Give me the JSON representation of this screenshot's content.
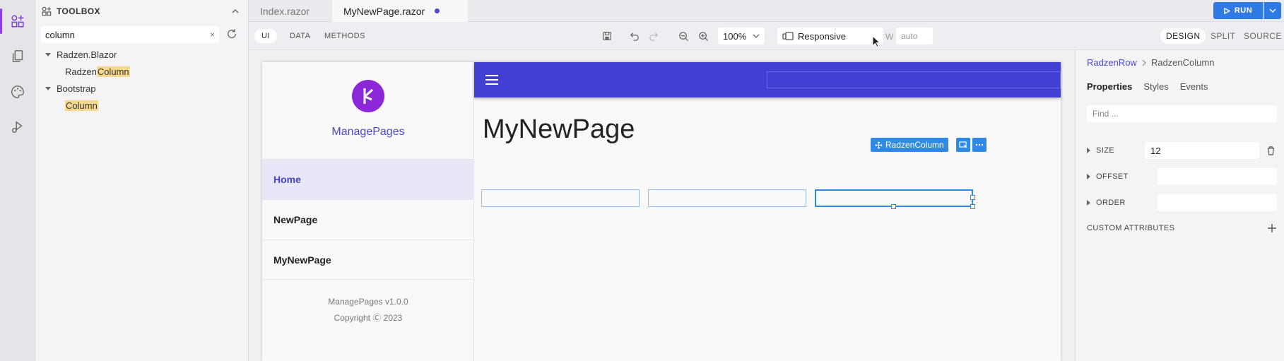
{
  "toolbox": {
    "title": "TOOLBOX",
    "search_value": "column",
    "clear_glyph": "×",
    "tree": [
      {
        "group": "Radzen.Blazor",
        "item_prefix": "Radzen",
        "item_match": "Column"
      },
      {
        "group": "Bootstrap",
        "item_prefix": "",
        "item_match": "Column"
      }
    ]
  },
  "tabs": [
    {
      "label": "Index.razor"
    },
    {
      "label": "MyNewPage.razor"
    }
  ],
  "run_label": "RUN",
  "toolbar": {
    "ui": "UI",
    "data": "DATA",
    "methods": "METHODS",
    "zoom": "100%",
    "device": "Responsive",
    "width_label": "W",
    "width_value": "auto"
  },
  "view": {
    "design": "DESIGN",
    "split": "SPLIT",
    "source": "SOURCE"
  },
  "preview": {
    "app_name": "ManagePages",
    "nav": [
      "Home",
      "NewPage",
      "MyNewPage"
    ],
    "version": "ManagePages v1.0.0",
    "copyright": "Copyright Ⓒ 2023",
    "page_title": "MyNewPage",
    "selected_component": "RadzenColumn"
  },
  "props": {
    "crumb_parent": "RadzenRow",
    "crumb_current": "RadzenColumn",
    "tabs": [
      "Properties",
      "Styles",
      "Events"
    ],
    "find_placeholder": "Find ...",
    "size_label": "SIZE",
    "size_value": "12",
    "offset_label": "OFFSET",
    "order_label": "ORDER",
    "custom_attributes_label": "CUSTOM ATTRIBUTES"
  },
  "colors": {
    "accent_purple": "#8b3fe6",
    "header_blue": "#4240d3",
    "run_blue": "#2f7ae5",
    "selection_blue": "#2f8ae5"
  }
}
